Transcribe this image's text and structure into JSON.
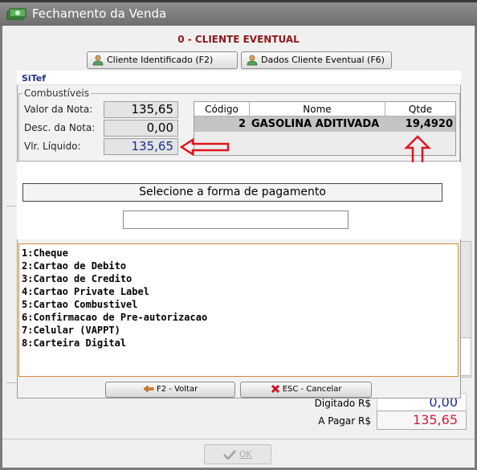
{
  "window": {
    "title": "Fechamento da Venda",
    "client_heading": "0 - CLIENTE EVENTUAL"
  },
  "tabs": [
    {
      "label": "Cliente Identificado (F2)"
    },
    {
      "label": "Dados Cliente Eventual (F6)"
    }
  ],
  "background": {
    "digitado_label": "Digitado  R$",
    "digitado_value": "0,00",
    "apagar_label": "A Pagar  R$",
    "apagar_value": "135,65",
    "ok_label": "OK",
    "colors": {
      "apagar": "#d0203a",
      "digitado": "#1b2d8f"
    }
  },
  "sitef": {
    "title": "SiTef",
    "combustiveis_legend": "Combustíveis",
    "fields": [
      {
        "label": "Valor da Nota:",
        "value": "135,65"
      },
      {
        "label": "Desc. da Nota:",
        "value": "0,00"
      },
      {
        "label": "Vlr. Líquido:",
        "value": "135,65"
      }
    ],
    "grid": {
      "headers": [
        "Código",
        "Nome",
        "Qtde"
      ],
      "rows": [
        {
          "codigo": "2",
          "nome": "GASOLINA ADITIVADA",
          "qtde": "19,4920"
        }
      ]
    },
    "prompt": "Selecione a forma de pagamento",
    "input_value": "",
    "options": [
      "1:Cheque",
      "2:Cartao de Debito",
      "3:Cartao de Credito",
      "4:Cartao Private Label",
      "5:Cartao Combustivel",
      "6:Confirmacao de Pre-autorizacao",
      "7:Celular (VAPPT)",
      "8:Carteira Digital"
    ],
    "buttons": {
      "back": "F2 - Voltar",
      "cancel": "ESC - Cancelar"
    },
    "annotation_color": "#e0161c"
  }
}
